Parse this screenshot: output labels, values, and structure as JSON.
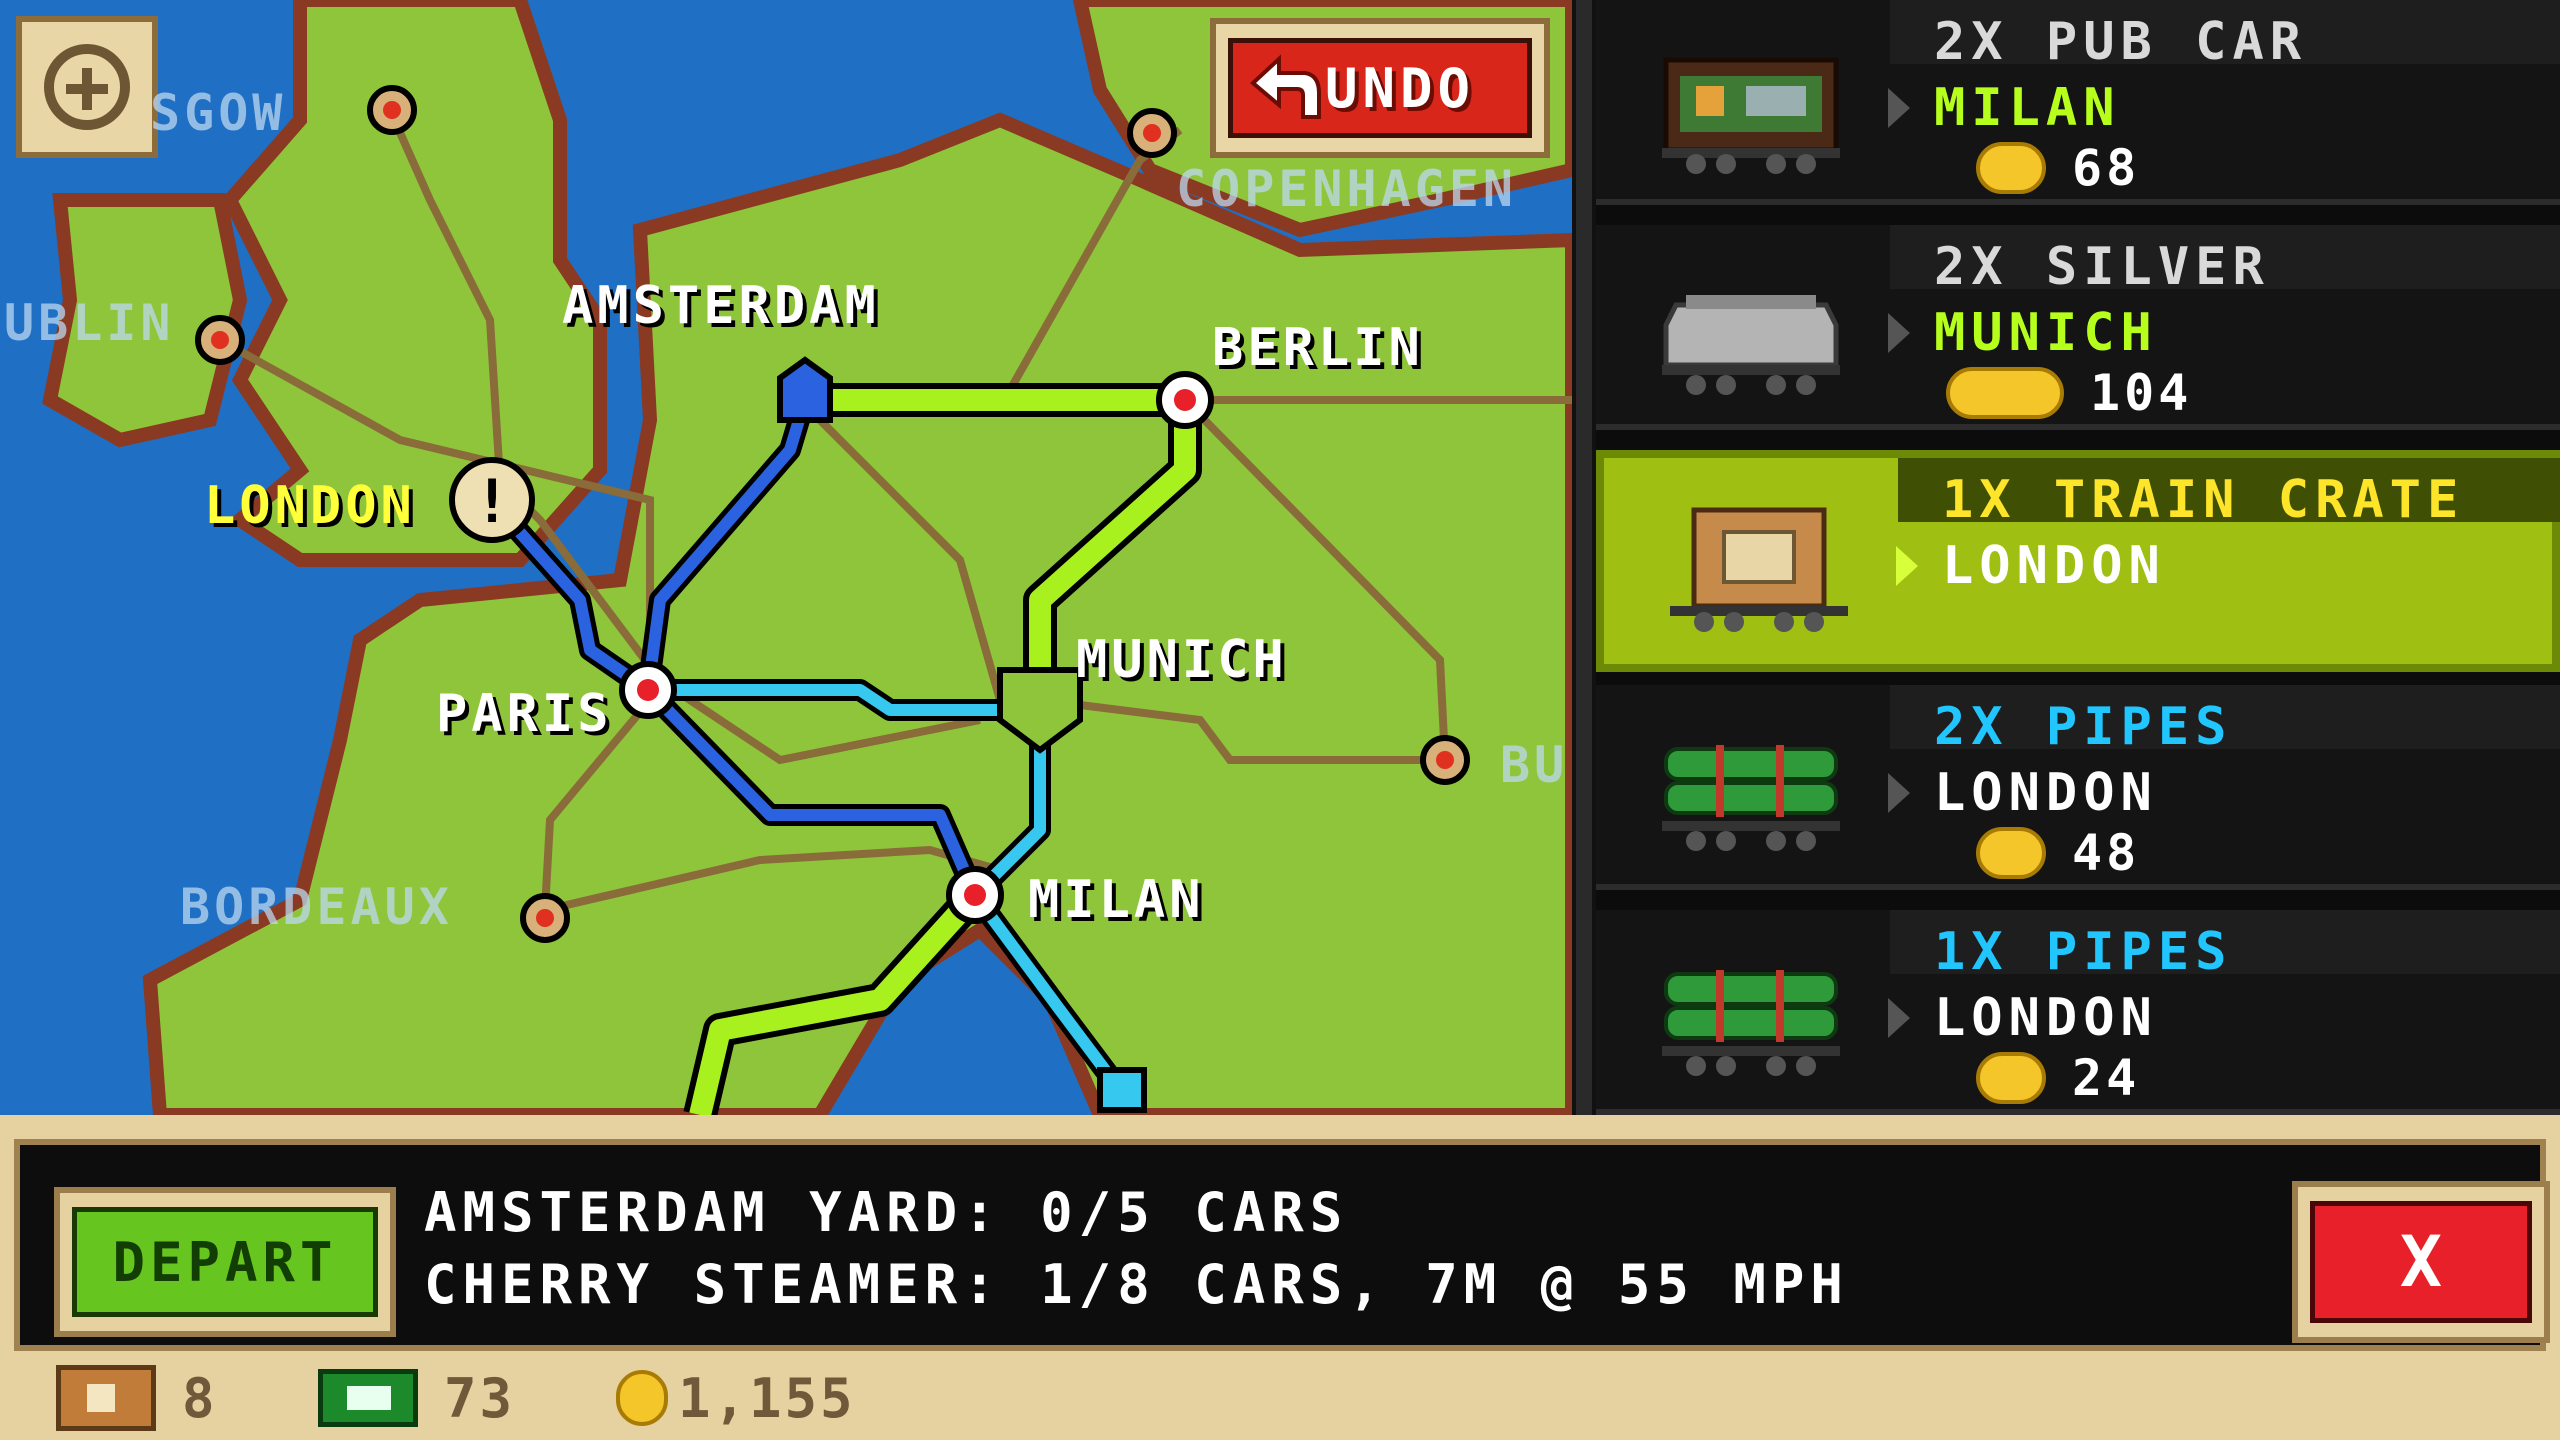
{
  "map": {
    "cities": {
      "glasgow": "SGOW",
      "dublin": "UBLIN",
      "amsterdam": "AMSTERDAM",
      "berlin": "BERLIN",
      "copenhagen": "COPENHAGEN",
      "london": "LONDON",
      "paris": "PARIS",
      "munich": "MUNICH",
      "bordeaux": "BORDEAUX",
      "milan": "MILAN",
      "budapest": "BU"
    },
    "zoom_icon": "plus-icon",
    "undo": {
      "label": "UNDO",
      "icon": "undo-arrow-icon"
    },
    "london_alert_icon": "exclamation-icon"
  },
  "cars": [
    {
      "title": "2X PUB CAR",
      "destination": "MILAN",
      "price": "68",
      "icon": "pub-car-icon",
      "selected": false
    },
    {
      "title": "2X SILVER",
      "destination": "MUNICH",
      "price": "104",
      "icon": "silver-hopper-icon",
      "selected": false
    },
    {
      "title": "1X TRAIN CRATE",
      "destination": "LONDON",
      "price": "",
      "icon": "crate-car-icon",
      "selected": true
    },
    {
      "title": "2X PIPES",
      "destination": "LONDON",
      "price": "48",
      "icon": "pipes-car-icon",
      "selected": false
    },
    {
      "title": "1X PIPES",
      "destination": "LONDON",
      "price": "24",
      "icon": "pipes-car-icon",
      "selected": false
    }
  ],
  "bottom": {
    "depart_label": "DEPART",
    "yard_status": "AMSTERDAM YARD: 0/5 CARS",
    "train_status": "CHERRY STEAMER: 1/8 CARS, 7M @ 55 MPH",
    "close_label": "X"
  },
  "resources": {
    "crates": "8",
    "cash": "73",
    "coins": "1,155"
  },
  "colors": {
    "sea": "#1f6fc4",
    "land": "#8fc53a",
    "selected_row": "#9fbf12",
    "route_green": "#a8f01e",
    "route_blue": "#2a62e0",
    "route_cyan": "#36c8ee"
  }
}
